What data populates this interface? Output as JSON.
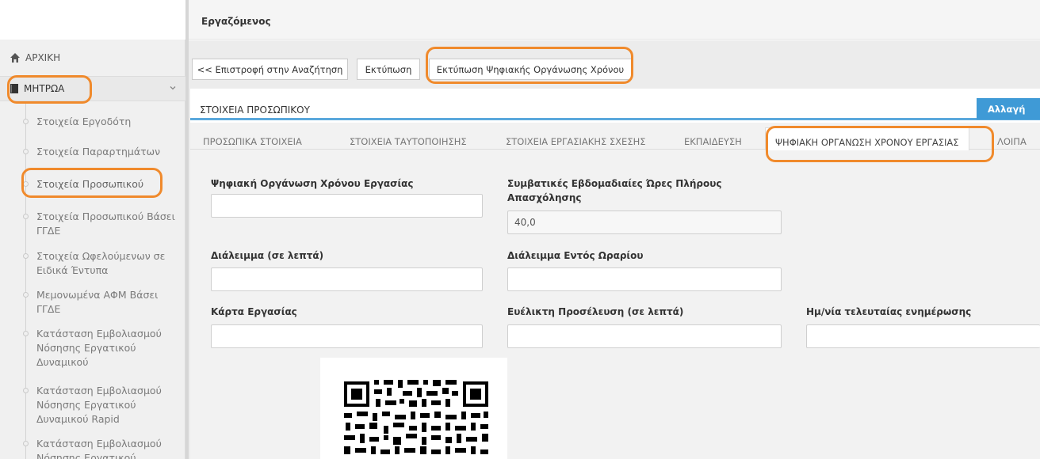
{
  "header": {
    "title": "Εργαζόμενος"
  },
  "sidebar": {
    "home_label": "ΑΡΧΙΚΗ",
    "registry_label": "ΜΗΤΡΩΑ",
    "items": [
      {
        "label": "Στοιχεία Εργοδότη"
      },
      {
        "label": "Στοιχεία Παραρτημάτων"
      },
      {
        "label": "Στοιχεία Προσωπικού"
      },
      {
        "label": "Στοιχεία Προσωπικού Βάσει ΓΓΔΕ"
      },
      {
        "label": "Στοιχεία Ωφελούμενων σε Ειδικά Έντυπα"
      },
      {
        "label": "Μεμονωμένα ΑΦΜ Βάσει ΓΓΔΕ"
      },
      {
        "label": "Κατάσταση Εμβολιασμού Νόσησης Εργατικού Δυναμικού"
      },
      {
        "label": "Κατάσταση Εμβολιασμού Νόσησης Εργατικού Δυναμικού Rapid"
      },
      {
        "label": "Κατάσταση Εμβολιασμού Νόσησης Εργατικού"
      }
    ]
  },
  "toolbar": {
    "back_label": "<< Επιστροφή στην Αναζήτηση",
    "print_label": "Εκτύπωση",
    "print_digital_label": "Εκτύπωση Ψηφιακής Οργάνωσης Χρόνου"
  },
  "panel": {
    "title": "ΣΤΟΙΧΕΙΑ ΠΡΟΣΩΠΙΚΟΥ",
    "change_button": "Αλλαγή"
  },
  "tabs": [
    {
      "label": "ΠΡΟΣΩΠΙΚΑ ΣΤΟΙΧΕΙΑ"
    },
    {
      "label": "ΣΤΟΙΧΕΙΑ ΤΑΥΤΟΠΟΙΗΣΗΣ"
    },
    {
      "label": "ΣΤΟΙΧΕΙΑ ΕΡΓΑΣΙΑΚΗΣ ΣΧΕΣΗΣ"
    },
    {
      "label": "ΕΚΠΑΙΔΕΥΣΗ"
    },
    {
      "label": "ΨΗΦΙΑΚΗ ΟΡΓΑΝΩΣΗ ΧΡΟΝΟΥ ΕΡΓΑΣΙΑΣ"
    },
    {
      "label": "ΛΟΙΠΑ"
    }
  ],
  "active_tab": 4,
  "fields": {
    "digital_org": {
      "label": "Ψηφιακή Οργάνωση Χρόνου Εργασίας",
      "value": ""
    },
    "weekly_hours": {
      "label": "Συμβατικές Εβδομαδιαίες Ώρες Πλήρους Απασχόλησης",
      "value": "40,0"
    },
    "break_minutes": {
      "label": "Διάλειμμα (σε λεπτά)",
      "value": ""
    },
    "break_within": {
      "label": "Διάλειμμα Εντός Ωραρίου",
      "value": ""
    },
    "work_card": {
      "label": "Κάρτα Εργασίας",
      "value": ""
    },
    "flex_arrival": {
      "label": "Ευέλικτη Προσέλευση (σε λεπτά)",
      "value": ""
    },
    "last_update": {
      "label": "Ημ/νία τελευταίας ενημέρωσης",
      "value": ""
    }
  },
  "colors": {
    "accent": "#3f9ad6",
    "highlight": "#f08a2c",
    "tab_underline": "#5aa8dc"
  }
}
